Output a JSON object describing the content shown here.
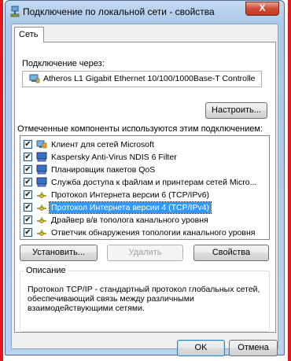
{
  "window": {
    "title": "Подключение по локальной сети - свойства",
    "close_label": "X"
  },
  "tabs": [
    {
      "label": "Сеть"
    }
  ],
  "connect_using": {
    "label": "Подключение через:",
    "adapter": "Atheros L1 Gigabit Ethernet 10/100/1000Base-T Controlle",
    "configure_label": "Настроить..."
  },
  "components": {
    "label": "Отмеченные компоненты используются этим подключением:",
    "items": [
      {
        "label": "Клиент для сетей Microsoft",
        "checked": true,
        "icon": "network-client-icon",
        "selected": false
      },
      {
        "label": "Kaspersky Anti-Virus NDIS 6 Filter",
        "checked": true,
        "icon": "service-icon",
        "selected": false
      },
      {
        "label": "Планировщик пакетов QoS",
        "checked": true,
        "icon": "service-icon",
        "selected": false
      },
      {
        "label": "Служба доступа к файлам и принтерам сетей Micro...",
        "checked": true,
        "icon": "service-icon",
        "selected": false
      },
      {
        "label": "Протокол Интернета версии 6 (TCP/IPv6)",
        "checked": true,
        "icon": "protocol-icon",
        "selected": false
      },
      {
        "label": "Протокол Интернета версии 4 (TCP/IPv4)",
        "checked": true,
        "icon": "protocol-icon",
        "selected": true
      },
      {
        "label": "Драйвер в/в тополога канального уровня",
        "checked": true,
        "icon": "protocol-icon",
        "selected": false
      },
      {
        "label": "Ответчик обнаружения топологии канального уровня",
        "checked": true,
        "icon": "protocol-icon",
        "selected": false
      }
    ]
  },
  "buttons": {
    "install": "Установить...",
    "uninstall": "Удалить",
    "properties": "Свойства",
    "ok": "OK",
    "cancel": "Отмена"
  },
  "description": {
    "label": "Описание",
    "text": "Протокол TCP/IP - стандартный протокол глобальных сетей, обеспечивающий связь между различными взаимодействующими сетями."
  },
  "colors": {
    "selection": "#3399ff",
    "window_frame": "#b9d3ee",
    "close_button": "#cf4c34"
  }
}
